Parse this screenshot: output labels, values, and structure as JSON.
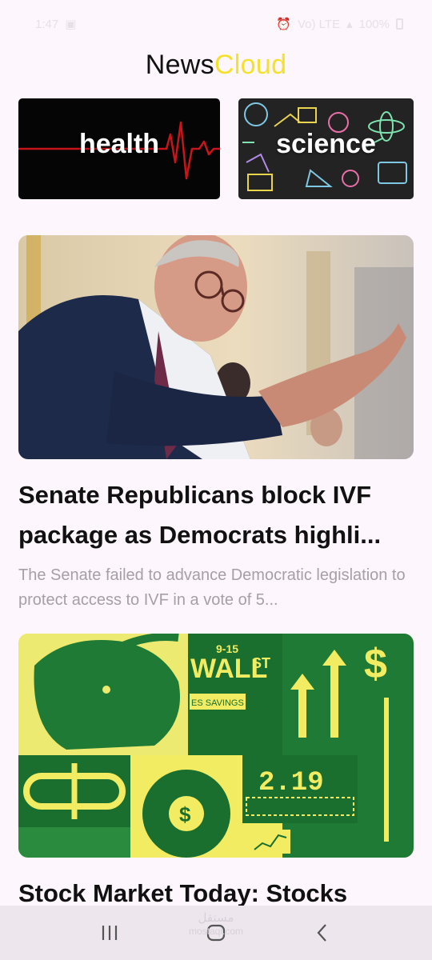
{
  "status_bar": {
    "time": "1:47",
    "signal_text": "Vo) LTE",
    "battery": "100%"
  },
  "app": {
    "title_part1": "News",
    "title_part2": "Cloud",
    "accent_color": "#f4e12e"
  },
  "categories": [
    {
      "label": "health",
      "icon": "heartbeat-line"
    },
    {
      "label": "science",
      "icon": "science-doodles"
    }
  ],
  "articles": [
    {
      "title": "Senate Republicans block IVF package as Democrats highli...",
      "summary": "The Senate failed to advance Democratic legislation to protect access to IVF in a vote of 5..."
    },
    {
      "title": "Stock Market Today: Stocks",
      "summary": ""
    }
  ],
  "image_text": {
    "wall": "WALL",
    "st": "ST",
    "date": "9-15",
    "savings": "ES SAVINGS",
    "ticker": "2.19"
  },
  "nav": {
    "recents_icon": "recents-icon",
    "home_icon": "home-icon",
    "back_icon": "back-icon"
  },
  "watermark": {
    "arabic": "مستقل",
    "latin": "mostaql.com"
  }
}
